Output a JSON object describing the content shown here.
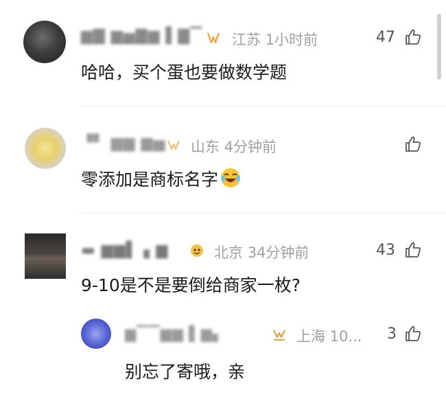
{
  "comments": [
    {
      "name": "▆▇ ▆▅▇▆ ▌▇▔",
      "location": "江苏",
      "time": "1小时前",
      "likes": "47",
      "text": "哈哈，买个蛋也要做数学题"
    },
    {
      "name": "▝▘ ▆▆ ▆▅",
      "location": "山东",
      "time": "4分钟前",
      "likes": "",
      "text": "零添加是商标名字"
    },
    {
      "name": "▬ ▆▆▌ ▖▆",
      "location": "北京",
      "time": "34分钟前",
      "likes": "43",
      "text": "9-10是不是要倒给商家一枚?"
    }
  ],
  "reply": {
    "name": "▆▔▔▆▆  ▌▆▖",
    "location_time": "上海 10...",
    "likes": "3",
    "text": "别忘了寄哦，亲"
  },
  "colors": {
    "badge_orange": "#f2a13b",
    "meta_gray": "#a0a0a0",
    "divider": "#ececec"
  },
  "icons": {
    "like": "thumbs-up-icon",
    "badge": "fan-badge-icon",
    "emoji": "laughing-crying-emoji-icon"
  }
}
